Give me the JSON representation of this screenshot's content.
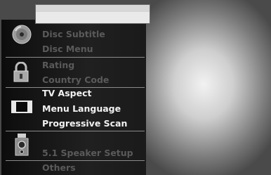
{
  "menu": {
    "groups": [
      {
        "icon": "disc-icon",
        "items": [
          {
            "label": "Disc Subtitle",
            "active": false
          },
          {
            "label": "Disc Menu",
            "active": false
          }
        ]
      },
      {
        "icon": "lock-icon",
        "items": [
          {
            "label": "Rating",
            "active": false
          },
          {
            "label": "Country Code",
            "active": false
          }
        ]
      },
      {
        "icon": "tv-screen-icon",
        "items": [
          {
            "label": "TV Aspect",
            "active": true
          },
          {
            "label": "Menu Language",
            "active": true
          },
          {
            "label": "Progressive Scan",
            "active": true
          }
        ]
      },
      {
        "icon": "speaker-icon",
        "items": [
          {
            "label": "5.1 Speaker Setup",
            "active": false
          }
        ]
      },
      {
        "icon": "",
        "items": [
          {
            "label": "Others",
            "active": false
          }
        ]
      }
    ]
  }
}
